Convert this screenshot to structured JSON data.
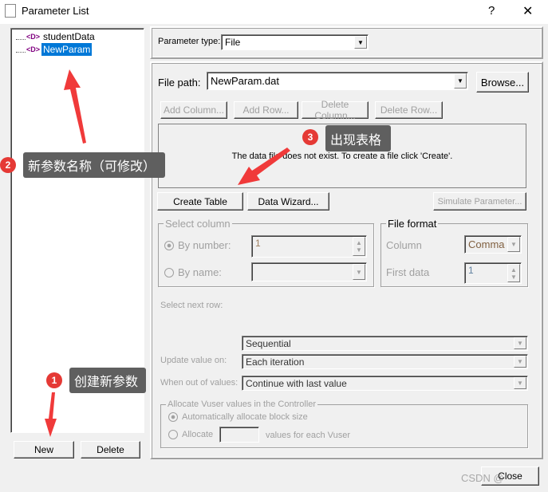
{
  "window": {
    "title": "Parameter List",
    "help": "?",
    "close": "✕"
  },
  "tree": {
    "items": [
      {
        "label": "studentData",
        "selected": false
      },
      {
        "label": "NewParam",
        "selected": true
      }
    ]
  },
  "left_buttons": {
    "new": "New",
    "delete": "Delete"
  },
  "param_type": {
    "label": "Parameter type:",
    "value": "File"
  },
  "file_path": {
    "label": "File path:",
    "value": "NewParam.dat",
    "browse": "Browse..."
  },
  "table_buttons": {
    "add_column": "Add Column...",
    "add_row": "Add Row...",
    "delete_column": "Delete Column...",
    "delete_row": "Delete Row..."
  },
  "message": "The data file does not exist. To create a file click 'Create'.",
  "actions": {
    "create_table": "Create Table",
    "data_wizard": "Data Wizard...",
    "simulate": "Simulate Parameter..."
  },
  "select_column": {
    "legend": "Select column",
    "by_number": "By number:",
    "by_number_value": "1",
    "by_name": "By name:"
  },
  "file_format": {
    "legend": "File format",
    "column_label": "Column",
    "column_value": "Comma",
    "first_data_label": "First data",
    "first_data_value": "1"
  },
  "next_row": {
    "label": "Select next row:",
    "value": "Sequential"
  },
  "update": {
    "label": "Update value on:",
    "value": "Each iteration"
  },
  "out_of_values": {
    "label": "When out of values:",
    "value": "Continue with last value"
  },
  "allocate": {
    "legend": "Allocate Vuser values in the Controller",
    "auto": "Automatically allocate block size",
    "allocate": "Allocate",
    "suffix": "values for each Vuser"
  },
  "close_button": "Close",
  "annotations": [
    {
      "num": "1",
      "text": "创建新参数"
    },
    {
      "num": "2",
      "text": "新参数名称（可修改）"
    },
    {
      "num": "3",
      "text": "出现表格"
    }
  ],
  "watermark": "CSDN @"
}
